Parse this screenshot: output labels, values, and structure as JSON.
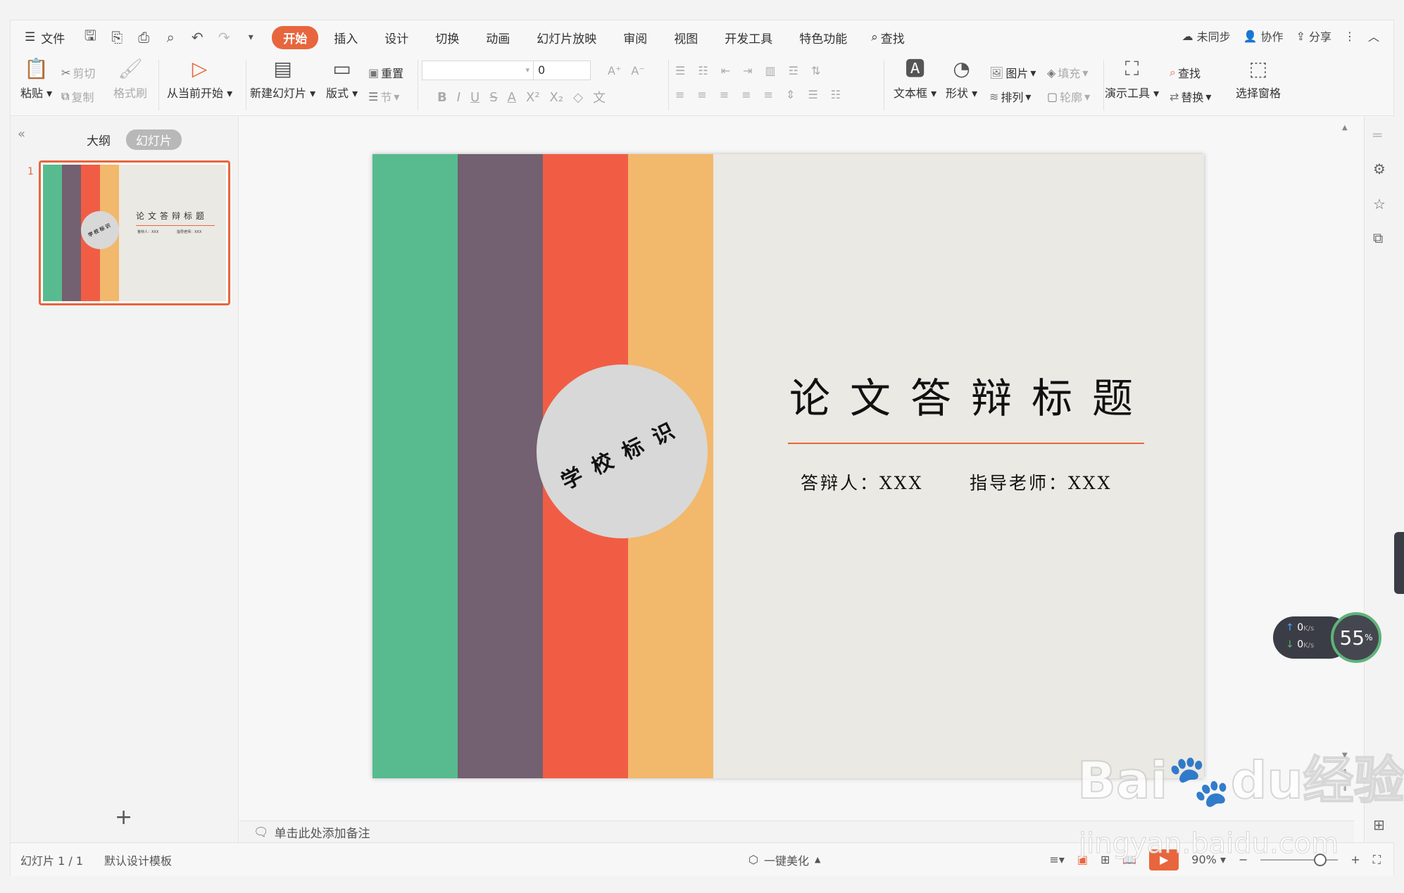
{
  "menubar": {
    "file": "文件",
    "tabs": [
      "开始",
      "插入",
      "设计",
      "切换",
      "动画",
      "幻灯片放映",
      "审阅",
      "视图",
      "开发工具",
      "特色功能"
    ],
    "search": "查找",
    "sync": "未同步",
    "collab": "协作",
    "share": "分享"
  },
  "ribbon": {
    "paste": "粘贴",
    "cut": "剪切",
    "copy": "复制",
    "format_painter": "格式刷",
    "from_current": "从当前开始",
    "new_slide": "新建幻灯片",
    "layout": "版式",
    "reset": "重置",
    "section": "节",
    "font_size": "0",
    "textbox": "文本框",
    "shape": "形状",
    "picture": "图片",
    "arrange": "排列",
    "fill": "填充",
    "outline": "轮廓",
    "present_tools": "演示工具",
    "find": "查找",
    "replace": "替换",
    "select_pane": "选择窗格"
  },
  "leftpanel": {
    "tab_outline": "大纲",
    "tab_slides": "幻灯片",
    "slide_number": "1"
  },
  "slide": {
    "logo_text": "学校标识",
    "title": "论文答辩标题",
    "presenter": "答辩人：XXX",
    "advisor": "指导老师：XXX",
    "colors": {
      "green": "#57bb8f",
      "purple": "#736070",
      "red": "#f05d44",
      "orange": "#f2b86c",
      "accent": "#e8663d"
    }
  },
  "notes": {
    "placeholder": "单击此处添加备注"
  },
  "status": {
    "slide_count": "幻灯片 1 / 1",
    "template": "默认设计模板",
    "beautify": "一键美化",
    "zoom": "90%"
  },
  "net_widget": {
    "up": "0",
    "down": "0",
    "unit": "K/s",
    "percent": "55"
  },
  "watermark": {
    "brand": "Bai",
    "brand_suffix": "du",
    "brand_cn": "经验",
    "url": "jingyan.baidu.com"
  }
}
